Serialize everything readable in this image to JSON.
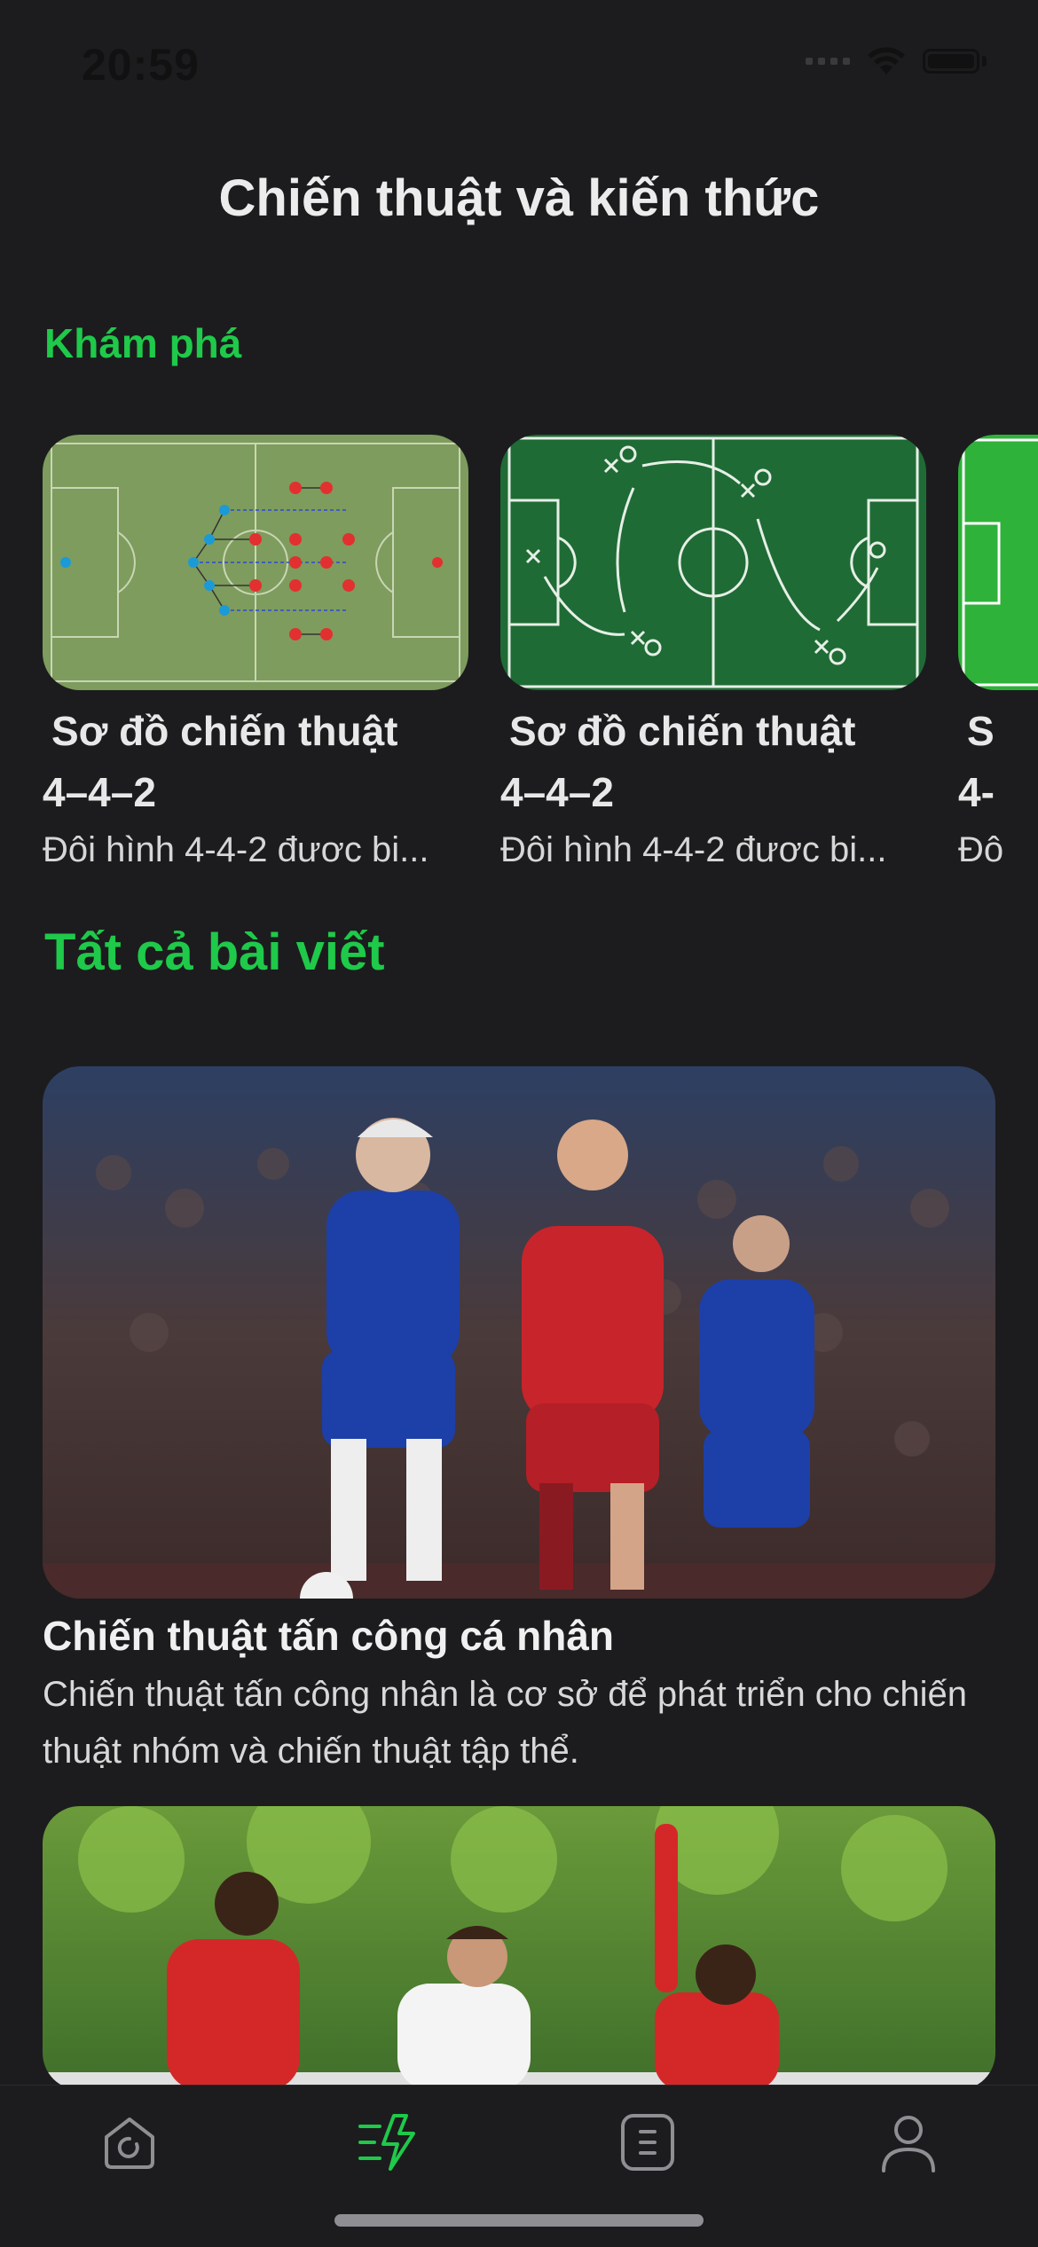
{
  "status": {
    "time": "20:59"
  },
  "page": {
    "title": "Chiến thuật và kiến thức"
  },
  "explore": {
    "heading": "Khám phá",
    "cards": [
      {
        "title_line1": " Sơ đồ chiến thuật",
        "title_line2": "4–4–2",
        "desc": "Đôi hình 4-4-2 đươc bi..."
      },
      {
        "title_line1": " Sơ đồ chiến thuật",
        "title_line2": "4–4–2",
        "desc": "Đôi hình 4-4-2 đươc bi..."
      },
      {
        "title_line1": " S",
        "title_line2": "4-",
        "desc": "Đô"
      }
    ]
  },
  "all_posts": {
    "heading": "Tất cả bài viết",
    "articles": [
      {
        "title": "Chiến thuật tấn công cá nhân",
        "desc": "Chiến thuật tấn công nhân là cơ sở để phát triển cho chiến thuật nhóm và chiến thuật tập thể."
      },
      {
        "title": "",
        "desc": ""
      }
    ]
  },
  "tabbar": {
    "items": [
      {
        "icon": "home-icon",
        "active": false
      },
      {
        "icon": "tactics-icon",
        "active": true
      },
      {
        "icon": "article-icon",
        "active": false
      },
      {
        "icon": "profile-icon",
        "active": false
      }
    ]
  },
  "colors": {
    "accent": "#1fc94a",
    "background": "#1c1c1e",
    "inactive_icon": "#8e8e93"
  }
}
